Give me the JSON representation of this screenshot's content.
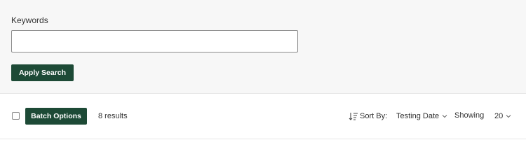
{
  "search": {
    "keywords_label": "Keywords",
    "keywords_value": "",
    "keywords_placeholder": "",
    "apply_label": "Apply Search"
  },
  "toolbar": {
    "select_all_checked": false,
    "batch_label": "Batch Options",
    "results_text": "8 results",
    "sort_by_label": "Sort By:",
    "sort_value": "Testing Date",
    "showing_label": "Showing",
    "showing_value": "20"
  },
  "icons": {
    "sort": "sort-icon",
    "chevron": "chevron-down-icon"
  },
  "colors": {
    "accent": "#1d4a36",
    "panel_bg": "#f7f7f7"
  }
}
